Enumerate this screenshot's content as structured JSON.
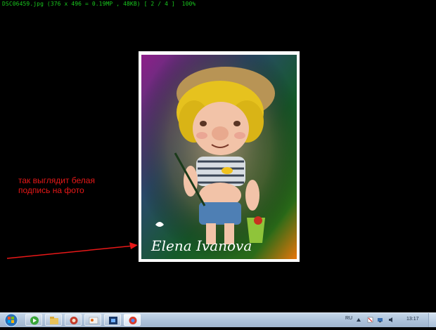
{
  "viewer": {
    "status_line": "DSC06459.jpg (376 x 496 = 0.19MP , 48KB) [ 2 / 4 ]  100%"
  },
  "photo": {
    "signature_text": "Elena Ivanova"
  },
  "annotation": {
    "text": "так выглядит белая\nподпись на фото",
    "color": "#e81818"
  },
  "taskbar": {
    "items": [
      "start",
      "media-player",
      "explorer",
      "browser",
      "paint",
      "photoshop",
      "chrome"
    ],
    "language": "RU",
    "clock": "13:17"
  },
  "colors": {
    "background": "#000000",
    "status_text": "#19c81e",
    "taskbar": "#b3c7de"
  }
}
